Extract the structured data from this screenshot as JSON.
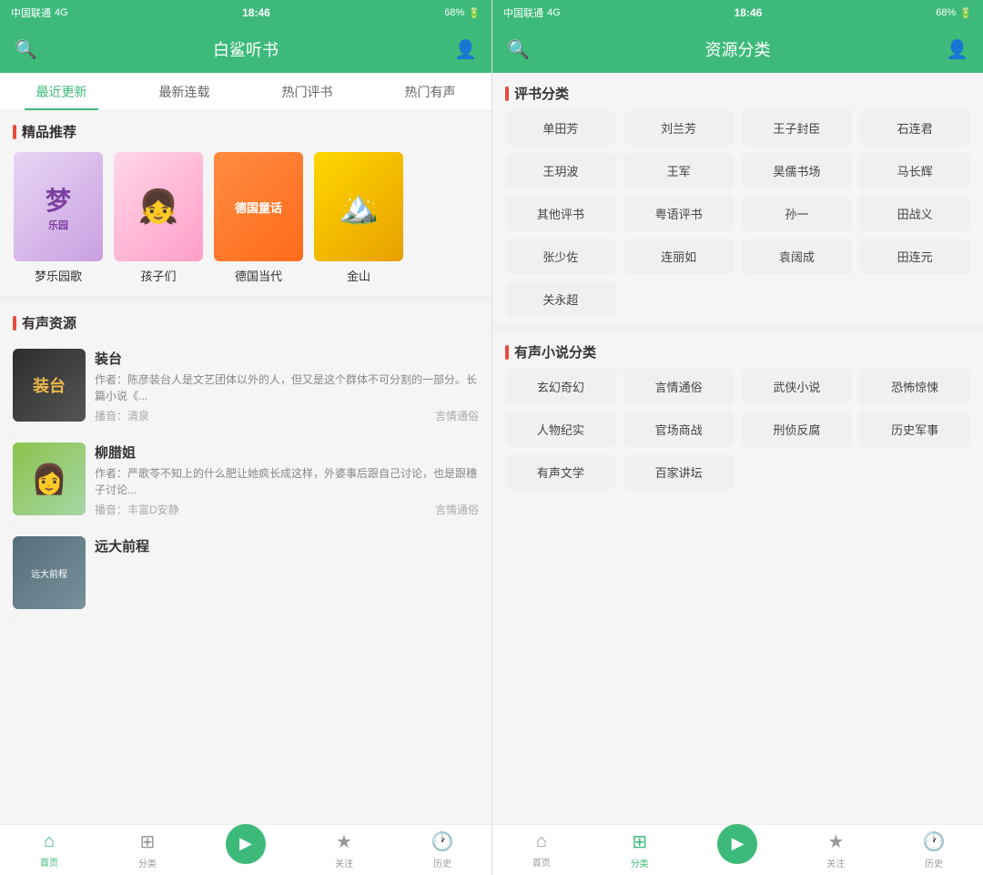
{
  "left_screen": {
    "status": {
      "carrier": "中国联通",
      "network": "4G",
      "time": "18:46",
      "battery": "68%"
    },
    "header": {
      "title": "白鲨听书",
      "search_label": "🔍",
      "user_label": "👤"
    },
    "tabs": [
      {
        "label": "最近更新",
        "active": true
      },
      {
        "label": "最新连载",
        "active": false
      },
      {
        "label": "热门评书",
        "active": false
      },
      {
        "label": "热门有声",
        "active": false
      }
    ],
    "featured": {
      "section_title": "精品推荐",
      "items": [
        {
          "label": "梦乐园歌",
          "cover_type": "dream"
        },
        {
          "label": "孩子们",
          "cover_type": "kids"
        },
        {
          "label": "德国当代",
          "cover_type": "german"
        },
        {
          "label": "金山",
          "cover_type": "gold"
        }
      ]
    },
    "audio": {
      "section_title": "有声资源",
      "items": [
        {
          "title": "装台",
          "desc": "作者：陈彦装台人是文艺团体以外的人，但又是这个群体不可分割的一部分。长篇小说《...",
          "narrator": "播音：清泉",
          "genre": "言情通俗",
          "cover_type": "zt"
        },
        {
          "title": "柳腊姐",
          "desc": "作者：严歌苓不知上的什么肥让她疯长成这样，外婆事后跟自己讨论，也是跟穗子讨论...",
          "narrator": "播音：丰富D安静",
          "genre": "言情通俗",
          "cover_type": "liu"
        },
        {
          "title": "远大前程",
          "desc": "",
          "narrator": "",
          "genre": "",
          "cover_type": "yuan"
        }
      ]
    },
    "bottom_nav": [
      {
        "label": "首页",
        "icon": "⌂",
        "active": true
      },
      {
        "label": "分类",
        "icon": "⊞",
        "active": false
      },
      {
        "label": "",
        "icon": "▶",
        "active": false,
        "is_play": true
      },
      {
        "label": "关注",
        "icon": "★",
        "active": false
      },
      {
        "label": "历史",
        "icon": "🕐",
        "active": false
      }
    ]
  },
  "right_screen": {
    "status": {
      "carrier": "中国联通",
      "network": "4G",
      "time": "18:46",
      "battery": "68%"
    },
    "header": {
      "title": "资源分类",
      "search_label": "🔍",
      "user_label": "👤"
    },
    "pingbook_section": {
      "title": "评书分类",
      "categories": [
        [
          "单田芳",
          "刘兰芳",
          "王子封臣",
          "石连君"
        ],
        [
          "王玥波",
          "王军",
          "昊儒书场",
          "马长辉"
        ],
        [
          "其他评书",
          "粤语评书",
          "孙一",
          "田战义"
        ],
        [
          "张少佐",
          "连丽如",
          "袁阔成",
          "田连元"
        ],
        [
          "关永超"
        ]
      ]
    },
    "audio_novel_section": {
      "title": "有声小说分类",
      "categories": [
        [
          "玄幻奇幻",
          "言情通俗",
          "武侠小说",
          "恐怖惊悚"
        ],
        [
          "人物纪实",
          "官场商战",
          "刑侦反腐",
          "历史军事"
        ],
        [
          "有声文学",
          "百家讲坛"
        ]
      ]
    },
    "bottom_nav": [
      {
        "label": "首页",
        "icon": "⌂",
        "active": false
      },
      {
        "label": "分类",
        "icon": "⊞",
        "active": true
      },
      {
        "label": "",
        "icon": "▶",
        "active": false,
        "is_play": true
      },
      {
        "label": "关注",
        "icon": "★",
        "active": false
      },
      {
        "label": "历史",
        "icon": "🕐",
        "active": false
      }
    ]
  }
}
